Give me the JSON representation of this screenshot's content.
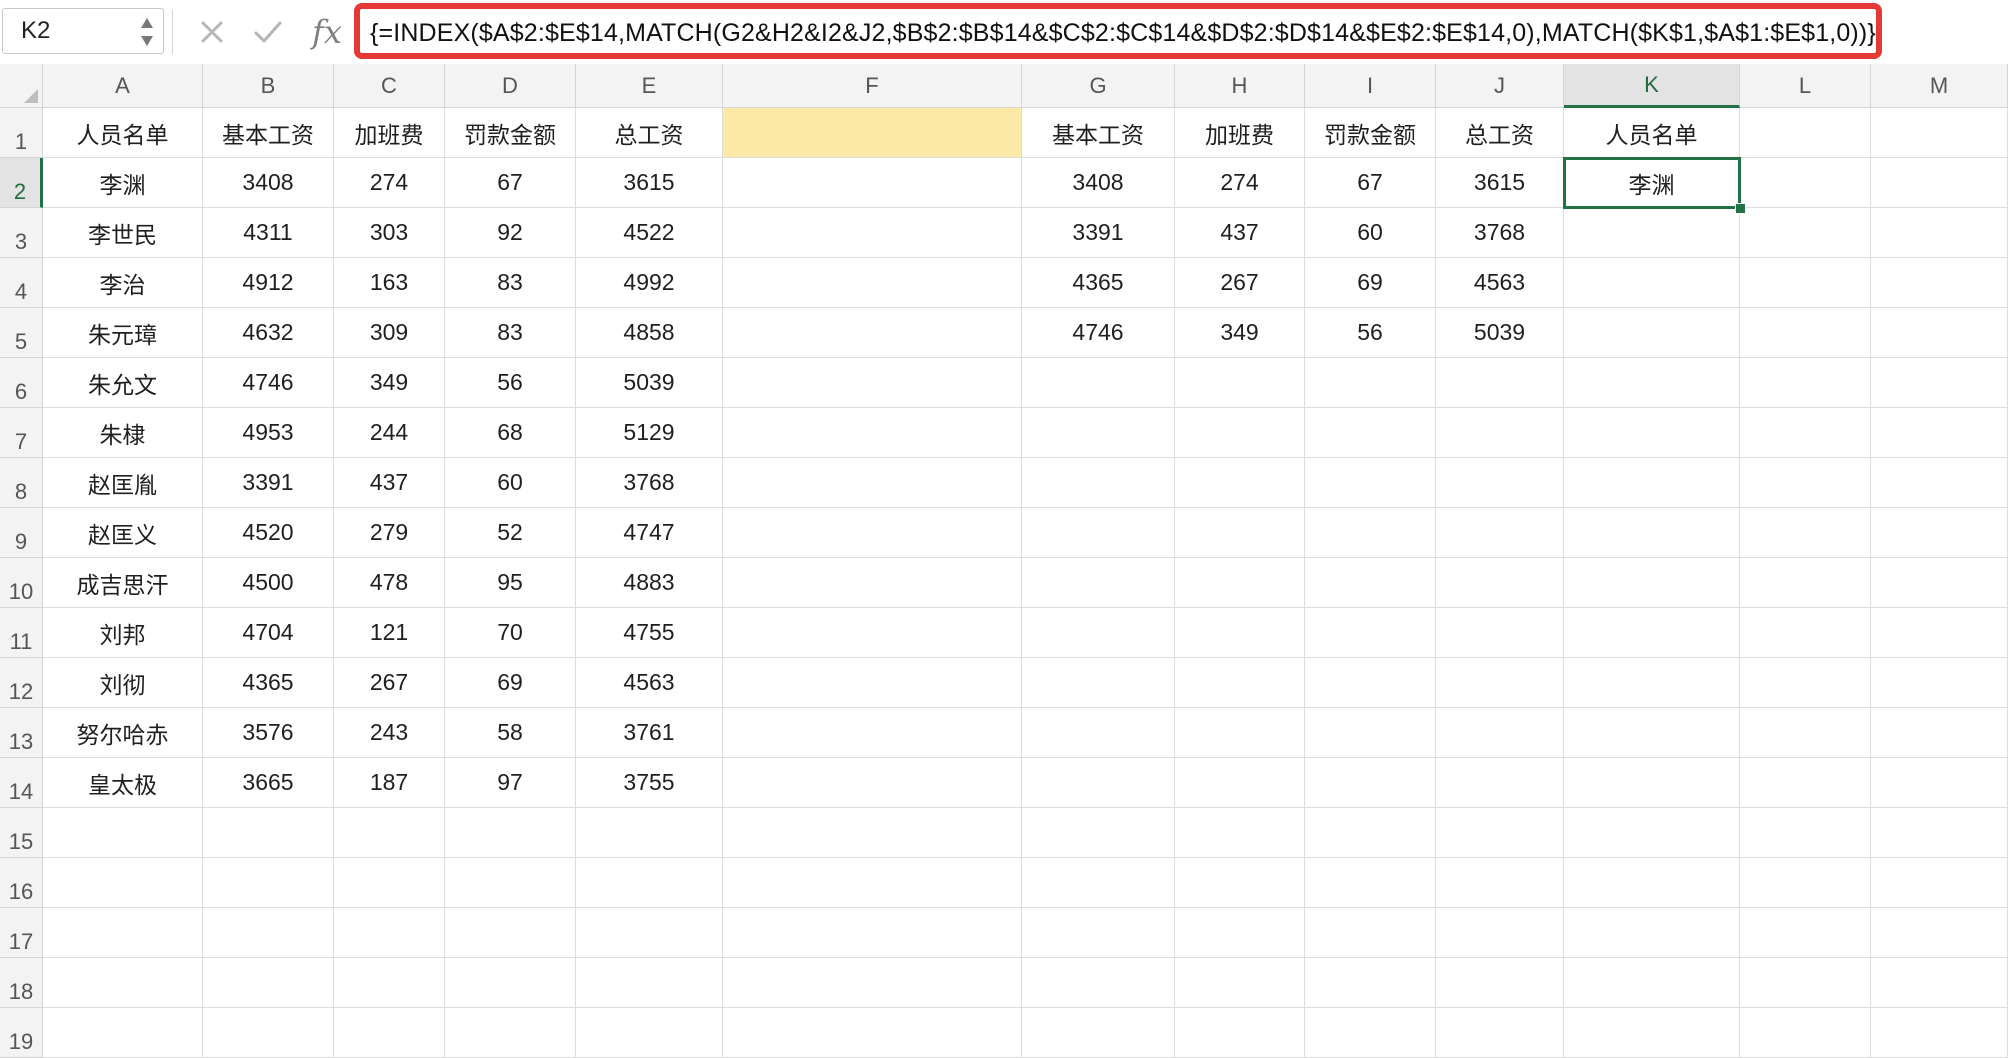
{
  "name_box": {
    "value": "K2"
  },
  "formula_bar": {
    "fx_label": "fx",
    "formula": "{=INDEX($A$2:$E$14,MATCH(G2&H2&I2&J2,$B$2:$B$14&$C$2:$C$14&$D$2:$D$14&$E$2:$E$14,0),MATCH($K$1,$A$1:$E$1,0))}"
  },
  "columns": [
    "A",
    "B",
    "C",
    "D",
    "E",
    "F",
    "G",
    "H",
    "I",
    "J",
    "K",
    "L",
    "M"
  ],
  "rows": [
    "1",
    "2",
    "3",
    "4",
    "5",
    "6",
    "7",
    "8",
    "9",
    "10",
    "11",
    "12",
    "13",
    "14",
    "15",
    "16",
    "17",
    "18",
    "19"
  ],
  "active_cell": {
    "column": "K",
    "row": "2"
  },
  "colors": {
    "highlight_fill": "#fde9a6",
    "selection": "#217346",
    "formula_outline": "#e53935"
  },
  "sheet": {
    "source_headers": [
      "人员名单",
      "基本工资",
      "加班费",
      "罚款金额",
      "总工资"
    ],
    "source_rows": [
      [
        "李渊",
        "3408",
        "274",
        "67",
        "3615"
      ],
      [
        "李世民",
        "4311",
        "303",
        "92",
        "4522"
      ],
      [
        "李治",
        "4912",
        "163",
        "83",
        "4992"
      ],
      [
        "朱元璋",
        "4632",
        "309",
        "83",
        "4858"
      ],
      [
        "朱允文",
        "4746",
        "349",
        "56",
        "5039"
      ],
      [
        "朱棣",
        "4953",
        "244",
        "68",
        "5129"
      ],
      [
        "赵匡胤",
        "3391",
        "437",
        "60",
        "3768"
      ],
      [
        "赵匡义",
        "4520",
        "279",
        "52",
        "4747"
      ],
      [
        "成吉思汗",
        "4500",
        "478",
        "95",
        "4883"
      ],
      [
        "刘邦",
        "4704",
        "121",
        "70",
        "4755"
      ],
      [
        "刘彻",
        "4365",
        "267",
        "69",
        "4563"
      ],
      [
        "努尔哈赤",
        "3576",
        "243",
        "58",
        "3761"
      ],
      [
        "皇太极",
        "3665",
        "187",
        "97",
        "3755"
      ]
    ],
    "lookup_headers": [
      "基本工资",
      "加班费",
      "罚款金额",
      "总工资",
      "人员名单"
    ],
    "lookup_rows": [
      [
        "3408",
        "274",
        "67",
        "3615",
        "李渊"
      ],
      [
        "3391",
        "437",
        "60",
        "3768",
        ""
      ],
      [
        "4365",
        "267",
        "69",
        "4563",
        ""
      ],
      [
        "4746",
        "349",
        "56",
        "5039",
        ""
      ]
    ]
  }
}
